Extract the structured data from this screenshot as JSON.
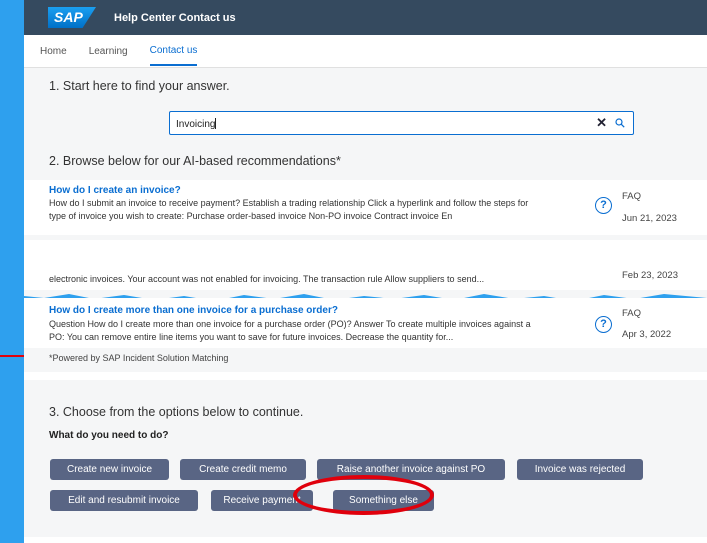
{
  "header": {
    "logo_text": "SAP",
    "title": "Help Center Contact us"
  },
  "nav": {
    "items": [
      {
        "label": "Home"
      },
      {
        "label": "Learning"
      },
      {
        "label": "Contact us",
        "active": true
      }
    ]
  },
  "step1": {
    "title": "1. Start here to find your answer.",
    "search_value": "Invoicing"
  },
  "step2": {
    "title": "2. Browse below for our AI-based recommendations*",
    "results": [
      {
        "title": "How do I create an invoice?",
        "snippet": "How do I submit an invoice to receive payment? Establish a trading relationship Click a hyperlink and follow the steps for type of invoice you wish to create: Purchase order-based invoice Non-PO invoice Contract invoice En",
        "type": "FAQ",
        "date": "Jun 21, 2023"
      },
      {
        "title": "",
        "snippet": "electronic invoices. Your account was not enabled for invoicing. The transaction rule Allow suppliers to send...",
        "type": "",
        "date": "Feb 23, 2023"
      },
      {
        "title": "How do I create more than one invoice for a purchase order?",
        "snippet": "Question How do I create more than one invoice for a purchase order (PO)? Answer To create multiple invoices against a PO: You can remove entire line items you want to save for future invoices. Decrease the quantity for...",
        "type": "FAQ",
        "date": "Apr 3, 2022"
      }
    ],
    "powered_by": "*Powered by SAP Incident Solution Matching"
  },
  "step3": {
    "title": "3. Choose from the options below to continue.",
    "question": "What do you need to do?",
    "options": [
      "Create new invoice",
      "Create credit memo",
      "Raise another invoice against PO",
      "Invoice was rejected",
      "Edit and resubmit invoice",
      "Receive payment",
      "Something else"
    ]
  },
  "colors": {
    "accent": "#0a6ed1",
    "button": "#596584",
    "header": "#354a5f",
    "annotation": "#e0000c"
  }
}
